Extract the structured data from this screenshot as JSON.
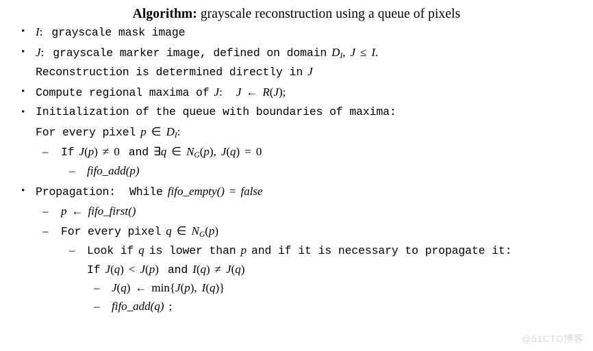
{
  "document": {
    "title_label": "Algorithm:",
    "title_text": "grayscale reconstruction using a queue of pixels",
    "watermark": "@51CTO博客"
  },
  "algorithm": {
    "steps": [
      {
        "id": "mask-image",
        "symbol": "I",
        "colon": ":",
        "text": "grayscale mask image"
      },
      {
        "id": "marker-image",
        "symbol": "J",
        "colon": ":",
        "text": "grayscale marker image, defined on domain",
        "domain_base": "D",
        "domain_sub": "I",
        "comma": ",",
        "rel_left": "J",
        "rel_op": "≤",
        "rel_right": "I",
        "period": ".",
        "continuation_text": "Reconstruction is determined directly in",
        "continuation_symbol": "J"
      },
      {
        "id": "compute-regional-maxima",
        "text": "Compute regional maxima of",
        "symbol": "J",
        "colon": ":",
        "assign_target": "J",
        "assign_arrow": "←",
        "assign_fn": "R",
        "assign_open": "(",
        "assign_arg": "J",
        "assign_close": ")",
        "semicolon": ";"
      },
      {
        "id": "initialization",
        "text": "Initialization of the queue with boundaries of maxima:",
        "loop_text": "For every pixel",
        "loop_var": "p",
        "loop_in": "∈",
        "loop_domain_base": "D",
        "loop_domain_sub": "I",
        "loop_colon": ":",
        "condition": {
          "id": "init-condition",
          "if": "If",
          "lhs_fn": "J",
          "lhs_open": "(",
          "lhs_arg": "p",
          "lhs_close": ")",
          "neq": "≠",
          "zero": "0",
          "and": "and",
          "exists": "∃",
          "exists_var": "q",
          "in": "∈",
          "nbr_base": "N",
          "nbr_sub": "G",
          "nbr_open": "(",
          "nbr_arg": "p",
          "nbr_close": ")",
          "comma": ",",
          "rhs_fn": "J",
          "rhs_open": "(",
          "rhs_arg": "q",
          "rhs_close": ")",
          "eq": "=",
          "rhs_zero": "0"
        },
        "action": {
          "id": "init-fifo-add",
          "fn": "fifo_add",
          "open": "(",
          "arg": "p",
          "close": ")"
        }
      },
      {
        "id": "propagation",
        "label": "Propagation:",
        "while": "While",
        "while_fn": "fifo_empty",
        "while_parens": "()",
        "while_eq": "=",
        "while_value": "false",
        "pop": {
          "id": "fifo-first",
          "var": "p",
          "arrow": "←",
          "fn": "fifo_first",
          "parens": "()"
        },
        "loop": {
          "id": "neighbor-loop",
          "text": "For every pixel",
          "var": "q",
          "in": "∈",
          "nbr_base": "N",
          "nbr_sub": "G",
          "nbr_open": "(",
          "nbr_arg": "p",
          "nbr_close": ")"
        },
        "look": {
          "id": "look-comment",
          "prefix": "Look if",
          "var_q": "q",
          "mid": "is lower than",
          "var_p": "p",
          "suffix": "and if it is necessary to propagate it:",
          "if": "If",
          "a_fn": "J",
          "a_open": "(",
          "a_arg": "q",
          "a_close": ")",
          "lt": "<",
          "b_fn": "J",
          "b_open": "(",
          "b_arg": "p",
          "b_close": ")",
          "and": "and",
          "c_fn": "I",
          "c_open": "(",
          "c_arg": "q",
          "c_close": ")",
          "neq": "≠",
          "d_fn": "J",
          "d_open": "(",
          "d_arg": "q",
          "d_close": ")"
        },
        "assign": {
          "id": "min-assignment",
          "target_fn": "J",
          "target_open": "(",
          "target_arg": "q",
          "target_close": ")",
          "arrow": "←",
          "min": "min",
          "brace_open": "{",
          "m1_fn": "J",
          "m1_open": "(",
          "m1_arg": "p",
          "m1_close": ")",
          "comma": ",",
          "m2_fn": "I",
          "m2_open": "(",
          "m2_arg": "q",
          "m2_close": ")",
          "brace_close": "}"
        },
        "enqueue": {
          "id": "prop-fifo-add",
          "fn": "fifo_add",
          "open": "(",
          "arg": "q",
          "close": ")",
          "semicolon": ";"
        }
      }
    ]
  },
  "glyphs": {
    "bullet": "•",
    "dash": "–"
  }
}
